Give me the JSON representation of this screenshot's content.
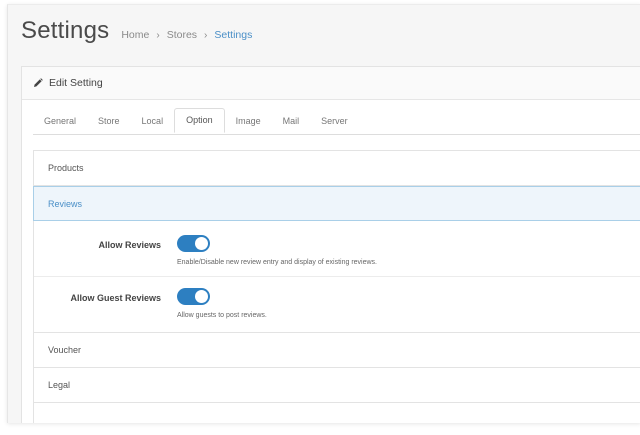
{
  "header": {
    "title": "Settings",
    "breadcrumb": [
      "Home",
      "Stores",
      "Settings"
    ],
    "separator": "›"
  },
  "panel": {
    "heading": "Edit Setting",
    "heading_icon": "pencil-icon"
  },
  "tabs": [
    {
      "label": "General",
      "active": false
    },
    {
      "label": "Store",
      "active": false
    },
    {
      "label": "Local",
      "active": false
    },
    {
      "label": "Option",
      "active": true
    },
    {
      "label": "Image",
      "active": false
    },
    {
      "label": "Mail",
      "active": false
    },
    {
      "label": "Server",
      "active": false
    }
  ],
  "accordion": {
    "products": "Products",
    "reviews": "Reviews",
    "voucher": "Voucher",
    "legal": "Legal"
  },
  "reviews": {
    "allow_reviews": {
      "label": "Allow Reviews",
      "enabled": true,
      "help": "Enable/Disable new review entry and display of existing reviews."
    },
    "allow_guest_reviews": {
      "label": "Allow Guest Reviews",
      "enabled": true,
      "help": "Allow guests to post reviews."
    }
  },
  "colors": {
    "accent": "#2d7fc1",
    "active_link": "#4a8fc7",
    "active_section_bg": "#eef5fb"
  }
}
